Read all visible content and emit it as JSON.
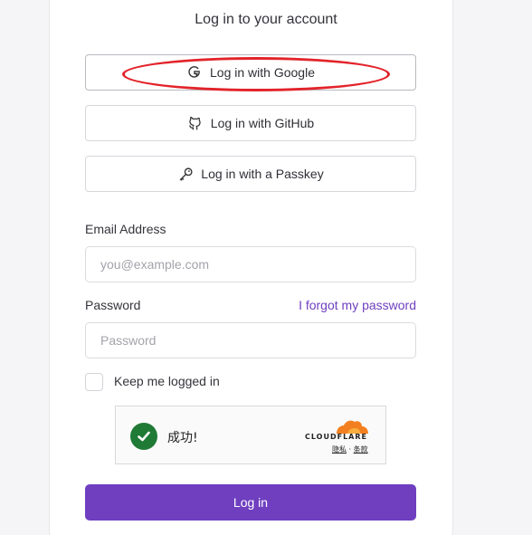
{
  "login": {
    "title": "Log in to your account",
    "google_label": "Log in with Google",
    "github_label": "Log in with GitHub",
    "passkey_label": "Log in with a Passkey",
    "email_label": "Email Address",
    "email_placeholder": "you@example.com",
    "password_label": "Password",
    "forgot_label": "I forgot my password",
    "password_placeholder": "Password",
    "keep_logged_in_label": "Keep me logged in",
    "submit_label": "Log in"
  },
  "captcha": {
    "status_text": "成功!",
    "brand": "CLOUDFLARE",
    "privacy_link": "隐私",
    "separator": "·",
    "terms_link": "条款"
  },
  "colors": {
    "accent": "#6f3fc0",
    "annotation": "#e2232a",
    "success_green": "#1f7a36",
    "cloudflare_orange": "#f38020"
  },
  "icons": {
    "google": "google-icon",
    "github": "github-icon",
    "passkey": "key-icon",
    "success": "checkmark-icon"
  }
}
